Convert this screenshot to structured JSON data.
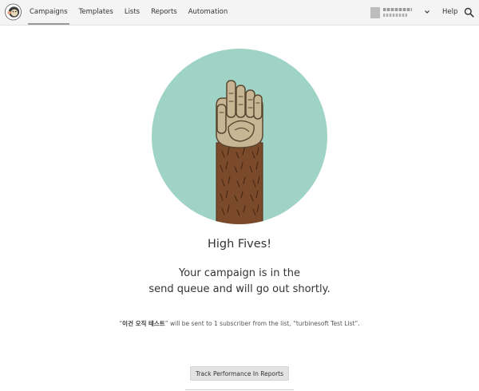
{
  "nav": {
    "items": [
      {
        "label": "Campaigns",
        "active": true
      },
      {
        "label": "Templates",
        "active": false
      },
      {
        "label": "Lists",
        "active": false
      },
      {
        "label": "Reports",
        "active": false
      },
      {
        "label": "Automation",
        "active": false
      }
    ],
    "help_label": "Help",
    "icons": {
      "logo": "mailchimp-freddie-logo",
      "account_menu": "chevron-down-icon",
      "search": "search-icon"
    }
  },
  "main": {
    "headline": "High Fives!",
    "subhead_line1": "Your campaign is in the",
    "subhead_line2": "send queue and will go out shortly.",
    "detail": {
      "open_quote": "“",
      "campaign_name": "이건 오직 테스트",
      "close_quote": "”",
      "message": " will be sent to 1 subscriber from the list, “turbinesoft Test List”."
    },
    "track_button_label": "Track Performance In Reports",
    "illustration": "monkey-arm-high-five",
    "colors": {
      "circle": "#9fd3c5",
      "fur": "#7a4a2a",
      "hand": "#c8b594"
    }
  }
}
